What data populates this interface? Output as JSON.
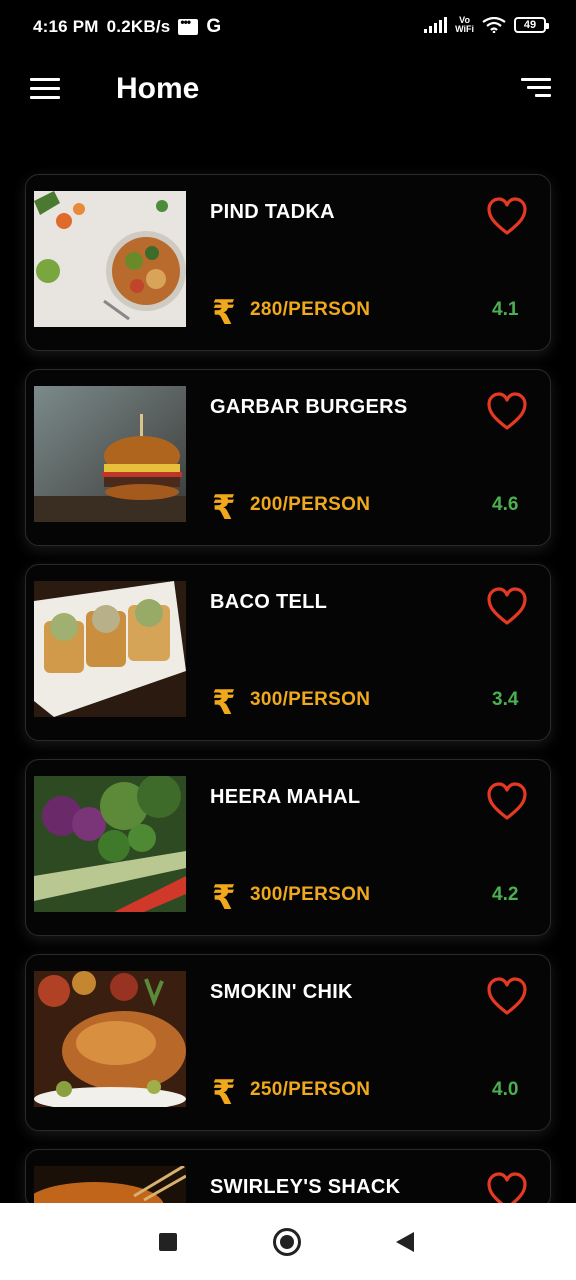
{
  "status_bar": {
    "time": "4:16 PM",
    "net_speed": "0.2KB/s",
    "carrier_icon": "G",
    "vowifi_top": "Vo",
    "vowifi_bottom": "WiFi",
    "battery": "49"
  },
  "app_bar": {
    "title": "Home",
    "menu_icon": "hamburger-menu-icon",
    "filter_icon": "sort-filter-icon"
  },
  "restaurants": [
    {
      "name": "PIND TADKA",
      "price": "280/PERSON",
      "rating": "4.1",
      "image": "salad-bowl"
    },
    {
      "name": "GARBAR BURGERS",
      "price": "200/PERSON",
      "rating": "4.6",
      "image": "burger"
    },
    {
      "name": "BACO TELL",
      "price": "300/PERSON",
      "rating": "3.4",
      "image": "tacos"
    },
    {
      "name": "HEERA MAHAL",
      "price": "300/PERSON",
      "rating": "4.2",
      "image": "vegetables"
    },
    {
      "name": "SMOKIN' CHIK",
      "price": "250/PERSON",
      "rating": "4.0",
      "image": "roast-chicken"
    },
    {
      "name": "SWIRLEY'S SHACK",
      "price": "",
      "rating": "",
      "image": "noodles"
    }
  ],
  "currency_symbol": "₹",
  "colors": {
    "accent_price": "#f0a81c",
    "rating": "#4caf50",
    "heart": "#e53923",
    "background": "#000000"
  }
}
